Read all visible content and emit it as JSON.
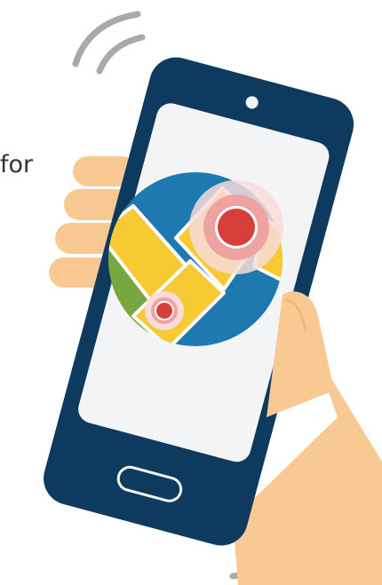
{
  "fragment_text": "for",
  "illustration": {
    "subject": "hand-holding-smartphone-with-map-location-pins",
    "icons": [
      "vibration-waves-icon",
      "map-icon",
      "location-pin-icon",
      "home-button-icon",
      "camera-icon"
    ]
  },
  "colors": {
    "phone_body": "#0f3a5f",
    "screen": "#f3f4f6",
    "skin": "#f9c994",
    "skin_shadow": "#efb87e",
    "waves": "#a9a9a9",
    "map_water": "#1f79b1",
    "map_green": "#78a740",
    "map_yellow": "#f7c932",
    "pin_red": "#d63f3a",
    "pin_ring": "#eea3a1",
    "pin_halo": "#f7dcdb"
  }
}
